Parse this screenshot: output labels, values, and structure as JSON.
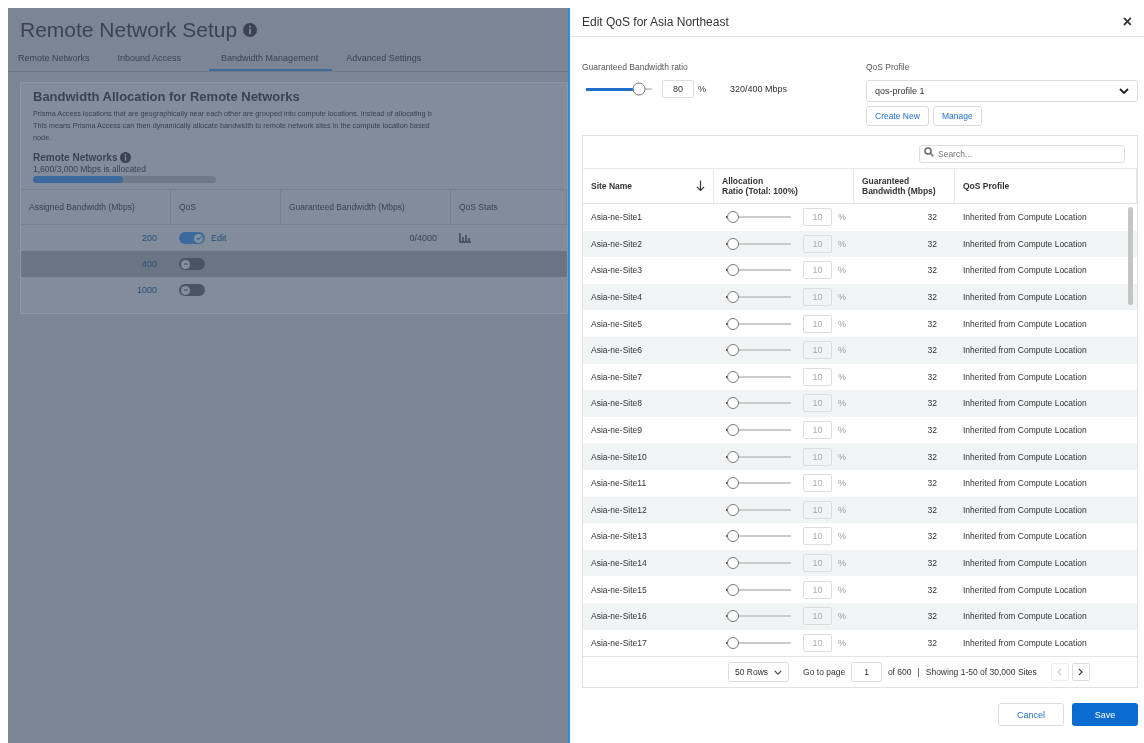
{
  "page": {
    "title": "Remote Network Setup",
    "tabs": [
      {
        "label": "Remote Networks",
        "selected": false
      },
      {
        "label": "Inbound Access",
        "selected": false
      },
      {
        "label": "Bandwidth Management",
        "selected": true
      },
      {
        "label": "Advanced Settings",
        "selected": false
      }
    ],
    "section": {
      "title": "Bandwidth Allocation for Remote Networks",
      "description_lines": [
        "Prisma Access locations that are geographically near each other are grouped into compute locations. Instead of allocating b",
        "This means Prisma Access can then dynamically allocate bandwidth to remote network sites in the compute location based",
        "node."
      ],
      "allocation": {
        "label": "Remote Networks",
        "reading": "1,600/3,000 Mbps is allocated",
        "level": 0.49
      }
    },
    "table": {
      "columns": [
        "Assigned Bandwidth (Mbps)",
        "QoS",
        "Guaranteed Bandwidth (Mbps)",
        "QoS Stats"
      ],
      "rows": [
        {
          "bandwidth": "200",
          "qos_on": true,
          "edit": "Edit",
          "guaranteed": "0/4000",
          "has_stats": true
        },
        {
          "bandwidth": "400",
          "qos_on": false
        },
        {
          "bandwidth": "1000",
          "qos_on": false
        }
      ]
    }
  },
  "dialog": {
    "title": "Edit QoS for Asia Northeast",
    "close": "×",
    "ratio": {
      "label": "Guaranteed Bandwidth ratio",
      "level": 0.8,
      "value": "80",
      "unit": "%",
      "reading": "320/400 Mbps"
    },
    "profile": {
      "label": "QoS Profile",
      "value": "qos-profile 1",
      "buttons": [
        "Create New",
        "Manage"
      ]
    },
    "search": {
      "placeholder": "Search..."
    },
    "columns": [
      "Site Name",
      "Allocation\nRatio (Total: 100%)",
      "Guaranteed\nBandwidth (Mbps)",
      "QoS Profile"
    ],
    "rows": [
      {
        "site": "Asia-ne-Site1",
        "level": 0.1,
        "ratio": "10",
        "unit": "%",
        "guaranteed": "32",
        "profile": "Inherited from Compute Location"
      },
      {
        "site": "Asia-ne-Site2",
        "level": 0.1,
        "ratio": "10",
        "unit": "%",
        "guaranteed": "32",
        "profile": "Inherited from Compute Location"
      },
      {
        "site": "Asia-ne-Site3",
        "level": 0.1,
        "ratio": "10",
        "unit": "%",
        "guaranteed": "32",
        "profile": "Inherited from Compute Location"
      },
      {
        "site": "Asia-ne-Site4",
        "level": 0.1,
        "ratio": "10",
        "unit": "%",
        "guaranteed": "32",
        "profile": "Inherited from Compute Location"
      },
      {
        "site": "Asia-ne-Site5",
        "level": 0.1,
        "ratio": "10",
        "unit": "%",
        "guaranteed": "32",
        "profile": "Inherited from Compute Location"
      },
      {
        "site": "Asia-ne-Site6",
        "level": 0.1,
        "ratio": "10",
        "unit": "%",
        "guaranteed": "32",
        "profile": "Inherited from Compute Location"
      },
      {
        "site": "Asia-ne-Site7",
        "level": 0.1,
        "ratio": "10",
        "unit": "%",
        "guaranteed": "32",
        "profile": "Inherited from Compute Location"
      },
      {
        "site": "Asia-ne-Site8",
        "level": 0.1,
        "ratio": "10",
        "unit": "%",
        "guaranteed": "32",
        "profile": "Inherited from Compute Location"
      },
      {
        "site": "Asia-ne-Site9",
        "level": 0.1,
        "ratio": "10",
        "unit": "%",
        "guaranteed": "32",
        "profile": "Inherited from Compute Location"
      },
      {
        "site": "Asia-ne-Site10",
        "level": 0.1,
        "ratio": "10",
        "unit": "%",
        "guaranteed": "32",
        "profile": "Inherited from Compute Location"
      },
      {
        "site": "Asia-ne-Site11",
        "level": 0.1,
        "ratio": "10",
        "unit": "%",
        "guaranteed": "32",
        "profile": "Inherited from Compute Location"
      },
      {
        "site": "Asia-ne-Site12",
        "level": 0.1,
        "ratio": "10",
        "unit": "%",
        "guaranteed": "32",
        "profile": "Inherited from Compute Location"
      },
      {
        "site": "Asia-ne-Site13",
        "level": 0.1,
        "ratio": "10",
        "unit": "%",
        "guaranteed": "32",
        "profile": "Inherited from Compute Location"
      },
      {
        "site": "Asia-ne-Site14",
        "level": 0.1,
        "ratio": "10",
        "unit": "%",
        "guaranteed": "32",
        "profile": "Inherited from Compute Location"
      },
      {
        "site": "Asia-ne-Site15",
        "level": 0.1,
        "ratio": "10",
        "unit": "%",
        "guaranteed": "32",
        "profile": "Inherited from Compute Location"
      },
      {
        "site": "Asia-ne-Site16",
        "level": 0.1,
        "ratio": "10",
        "unit": "%",
        "guaranteed": "32",
        "profile": "Inherited from Compute Location"
      },
      {
        "site": "Asia-ne-Site17",
        "level": 0.1,
        "ratio": "10",
        "unit": "%",
        "guaranteed": "32",
        "profile": "Inherited from Compute Location"
      }
    ],
    "pagination": {
      "rows_per_page": "50 Rows",
      "go_to": "Go to page",
      "page": "1",
      "of_pages": "of 600",
      "separator": "|",
      "showing": "Showing 1-50 of 30,000 Sites",
      "prev_disabled": true,
      "next_disabled": false
    },
    "buttons": {
      "cancel": "Cancel",
      "save": "Save"
    }
  }
}
